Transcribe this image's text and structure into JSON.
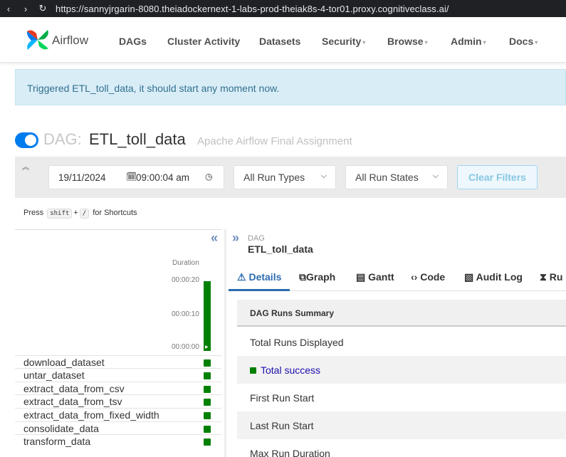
{
  "browser": {
    "back": "‹",
    "forward": "›",
    "reload": "↻",
    "url": "https://sannyjrgarin-8080.theiadockernext-1-labs-prod-theiak8s-4-tor01.proxy.cognitiveclass.ai/"
  },
  "navbar": {
    "brand": "Airflow",
    "items": [
      "DAGs",
      "Cluster Activity",
      "Datasets",
      "Security",
      "Browse",
      "Admin",
      "Docs"
    ]
  },
  "alert": {
    "message": "Triggered ETL_toll_data, it should start any moment now."
  },
  "dag": {
    "prefix": "DAG:",
    "id": "ETL_toll_data",
    "description": "Apache Airflow Final Assignment",
    "paused": false
  },
  "filters": {
    "date": "19/11/2024",
    "time": "09:00:04 am",
    "run_types": "All Run Types",
    "run_states": "All Run States",
    "clear_label": "Clear Filters"
  },
  "shortcuts": {
    "press": "Press",
    "key1": "shift",
    "plus": "+",
    "key2": "/",
    "suffix": "for Shortcuts"
  },
  "grid": {
    "duration_label": "Duration",
    "ticks": [
      "00:00:20",
      "00:00:10",
      "00:00:00"
    ],
    "tasks": [
      {
        "name": "download_dataset",
        "state": "success"
      },
      {
        "name": "untar_dataset",
        "state": "success"
      },
      {
        "name": "extract_data_from_csv",
        "state": "success"
      },
      {
        "name": "extract_data_from_tsv",
        "state": "success"
      },
      {
        "name": "extract_data_from_fixed_width",
        "state": "success"
      },
      {
        "name": "consolidate_data",
        "state": "success"
      },
      {
        "name": "transform_data",
        "state": "success"
      }
    ]
  },
  "details": {
    "dag_label": "DAG",
    "dag_id": "ETL_toll_data",
    "tabs": [
      "Details",
      "Graph",
      "Gantt",
      "Code",
      "Audit Log",
      "Ru"
    ],
    "summary_title": "DAG Runs Summary",
    "rows": [
      "Total Runs Displayed",
      "Total success",
      "First Run Start",
      "Last Run Start",
      "Max Run Duration"
    ]
  },
  "colors": {
    "accent": "#017cee",
    "success": "#008000",
    "link": "#2b6cb0"
  }
}
